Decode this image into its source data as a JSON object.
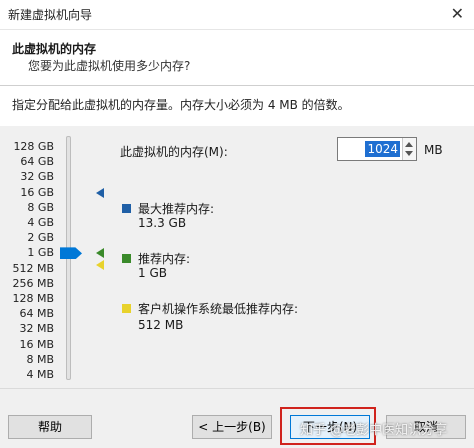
{
  "window": {
    "title": "新建虚拟机向导",
    "close_glyph": "✕"
  },
  "header": {
    "title": "此虚拟机的内存",
    "subtitle": "您要为此虚拟机使用多少内存?"
  },
  "instruction": "指定分配给此虚拟机的内存量。内存大小必须为 4 MB 的倍数。",
  "scale_labels": [
    "128 GB",
    "64 GB",
    "32 GB",
    "16 GB",
    "8 GB",
    "4 GB",
    "2 GB",
    "1 GB",
    "512 MB",
    "256 MB",
    "128 MB",
    "64 MB",
    "32 MB",
    "16 MB",
    "8 MB",
    "4 MB"
  ],
  "memory": {
    "label": "此虚拟机的内存(M):",
    "value": "1024",
    "unit": "MB"
  },
  "legend": {
    "max": {
      "title": "最大推荐内存:",
      "value": "13.3 GB",
      "color": "#1f5fa6"
    },
    "recommended": {
      "title": "推荐内存:",
      "value": "1 GB",
      "color": "#3a8a2a"
    },
    "min": {
      "title": "客户机操作系统最低推荐内存:",
      "value": "512 MB",
      "color": "#e8d22c"
    }
  },
  "buttons": {
    "help": "帮助",
    "back": "< 上一步(B)",
    "next": "下一步(N)",
    "cancel": "取消"
  },
  "watermark": "知乎 @老彭中医知识分享"
}
